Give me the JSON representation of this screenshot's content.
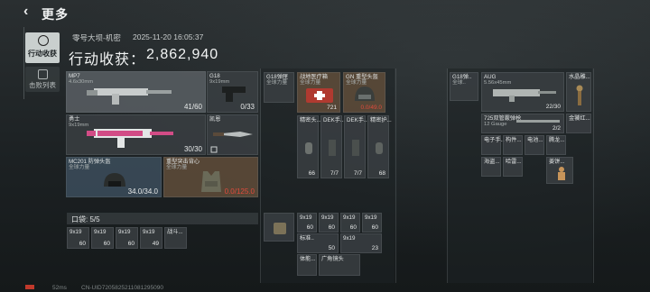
{
  "header": {
    "title": "更多"
  },
  "nav": [
    {
      "label": "行动收获",
      "active": true
    },
    {
      "label": "击败列表",
      "active": false
    }
  ],
  "info": {
    "operation": "零号大坝-机密",
    "datetime": "2025-11-20 16:05:37",
    "gain_label": "行动收获：",
    "gain_value": "2,862,940"
  },
  "loadout": {
    "mp7": {
      "name": "MP7",
      "ammo": "4.6x30mm",
      "count": "41/60"
    },
    "g18": {
      "name": "G18",
      "ammo": "9x19mm",
      "count": "0/33"
    },
    "warrior": {
      "name": "勇士",
      "ammo": "9x19mm",
      "count": "30/30"
    },
    "knife": {
      "name": "凯恩"
    },
    "helmet": {
      "name": "MC201 防弹头盔",
      "sub": "全球力量",
      "count": "34.0/34.0"
    },
    "armor": {
      "name": "重型突击背心",
      "sub": "全球力量",
      "count": "0.0/125.0"
    },
    "pouch_label": "口袋: 5/5",
    "pouch": [
      {
        "name": "9x19",
        "count": "60"
      },
      {
        "name": "9x19",
        "count": "60"
      },
      {
        "name": "9x19",
        "count": "60"
      },
      {
        "name": "9x19",
        "count": "49"
      },
      {
        "name": "战斗..."
      }
    ]
  },
  "rig": {
    "g18_slot": {
      "name": "G18弹匣",
      "sub": "全球力量"
    },
    "medkit": {
      "name": "战地医疗箱",
      "sub": "全球力量",
      "count": "721"
    },
    "gn_helmet": {
      "name": "GN 重型头盔",
      "sub": "全球力量",
      "count": "0.0/49.0"
    },
    "items": [
      {
        "name": "精密头...",
        "count": "66"
      },
      {
        "name": "DEK手...",
        "count": "7/7"
      },
      {
        "name": "DEK手...",
        "count": "7/7"
      },
      {
        "name": "精密护...",
        "count": "68"
      }
    ]
  },
  "backpack": {
    "items": [
      {
        "name": "9x19",
        "count": "60"
      },
      {
        "name": "9x19",
        "count": "60"
      },
      {
        "name": "9x19",
        "count": "60"
      },
      {
        "name": "9x19",
        "count": "60"
      },
      {
        "name": "标准..",
        "count": "50"
      },
      {
        "name": "9x19",
        "count": "23"
      },
      {
        "name": "体能..."
      },
      {
        "name": "广角镜头"
      }
    ]
  },
  "right": {
    "g18": {
      "name": "G18弹..",
      "sub": "全球.."
    },
    "aug": {
      "name": "AUG",
      "ammo": "5.56x45mm",
      "count": "22/30"
    },
    "statue": {
      "name": "水晶雕..."
    },
    "m725": {
      "name": "725双管霰弹枪",
      "ammo": "12 Gauge",
      "count": "2/2"
    },
    "gold": {
      "name": "金饕红..."
    },
    "small": [
      {
        "name": "电子手..."
      },
      {
        "name": "构件..."
      },
      {
        "name": "电池..."
      },
      {
        "name": "腾龙..."
      },
      {
        "name": "海盗..."
      },
      {
        "name": "哈雷..."
      },
      {
        "name": "姜饼..."
      }
    ]
  },
  "footer": {
    "ping": "52ms",
    "uid": "CN-UID7205825211081295090"
  },
  "colors": {
    "accent_red": "#e04b3c",
    "card": "#3a4043",
    "blue_card": "#3c4e5c",
    "brown_card": "#5c4a38"
  }
}
